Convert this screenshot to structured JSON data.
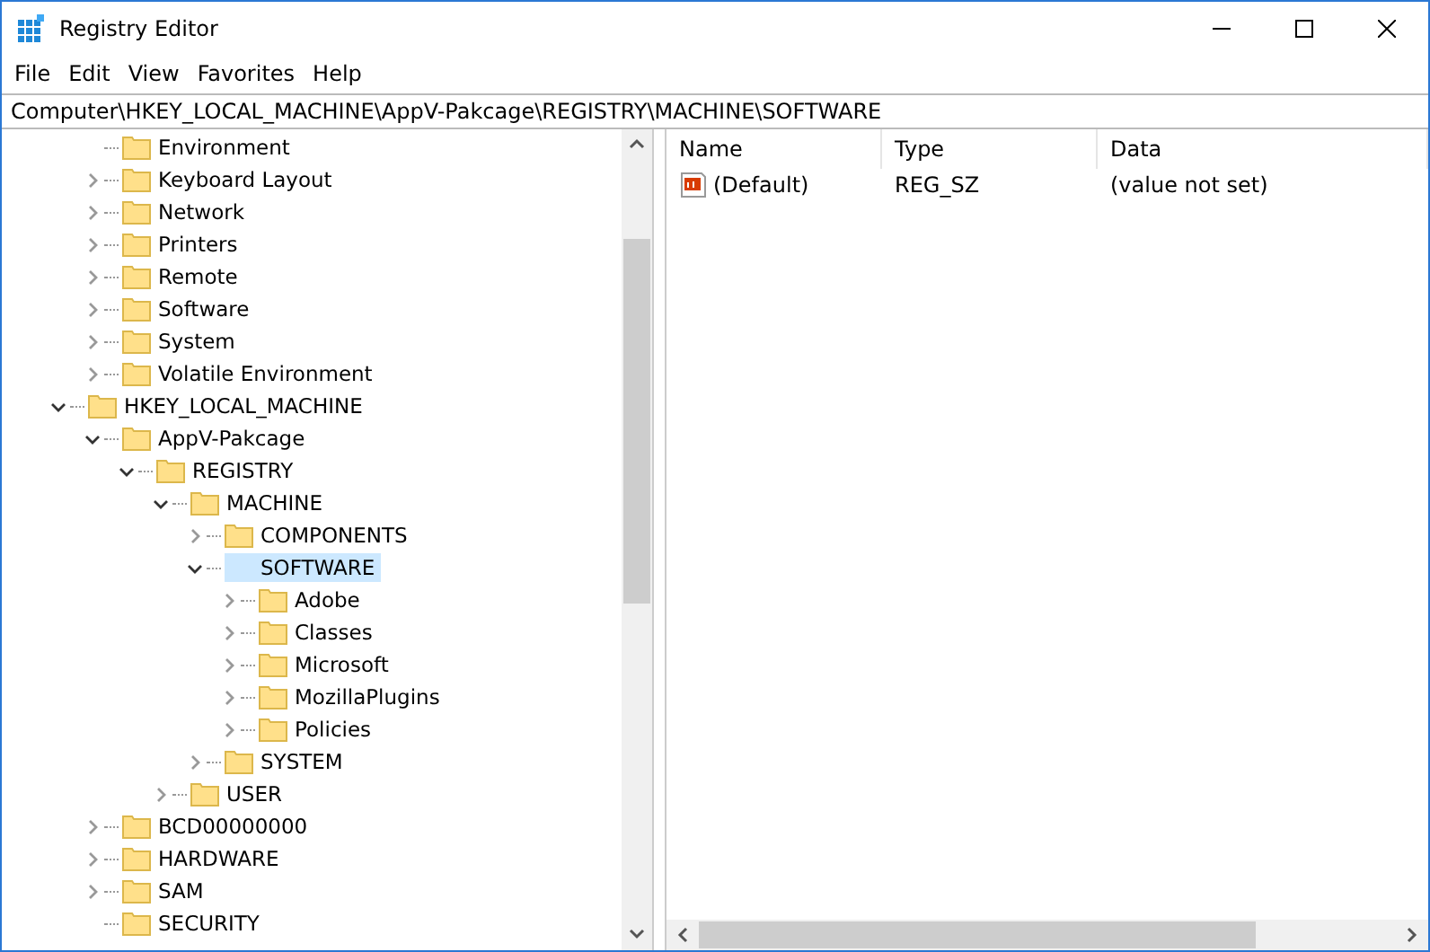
{
  "window": {
    "title": "Registry Editor"
  },
  "menu": [
    {
      "label": "File"
    },
    {
      "label": "Edit"
    },
    {
      "label": "View"
    },
    {
      "label": "Favorites"
    },
    {
      "label": "Help"
    }
  ],
  "address": "Computer\\HKEY_LOCAL_MACHINE\\AppV-Pakcage\\REGISTRY\\MACHINE\\SOFTWARE",
  "scrolled_branch": {
    "children": [
      {
        "label": "Environment",
        "selected": false
      },
      {
        "label": "Keyboard Layout",
        "expanded": false,
        "selected": false
      },
      {
        "label": "Network",
        "expanded": false,
        "selected": false
      },
      {
        "label": "Printers",
        "expanded": false,
        "selected": false
      },
      {
        "label": "Remote",
        "expanded": false,
        "selected": false
      },
      {
        "label": "Software",
        "expanded": false,
        "selected": false
      },
      {
        "label": "System",
        "expanded": false,
        "selected": false
      },
      {
        "label": "Volatile Environment",
        "expanded": false,
        "selected": false
      }
    ]
  },
  "tree": [
    {
      "label": "HKEY_LOCAL_MACHINE",
      "expanded": true,
      "selected": false,
      "children": [
        {
          "label": "AppV-Pakcage",
          "expanded": true,
          "selected": false,
          "children": [
            {
              "label": "REGISTRY",
              "expanded": true,
              "selected": false,
              "children": [
                {
                  "label": "MACHINE",
                  "expanded": true,
                  "selected": false,
                  "children": [
                    {
                      "label": "COMPONENTS",
                      "expanded": false,
                      "selected": false
                    },
                    {
                      "label": "SOFTWARE",
                      "expanded": true,
                      "selected": true,
                      "children": [
                        {
                          "label": "Adobe",
                          "expanded": false,
                          "selected": false
                        },
                        {
                          "label": "Classes",
                          "expanded": false,
                          "selected": false
                        },
                        {
                          "label": "Microsoft",
                          "expanded": false,
                          "selected": false
                        },
                        {
                          "label": "MozillaPlugins",
                          "expanded": false,
                          "selected": false
                        },
                        {
                          "label": "Policies",
                          "expanded": false,
                          "selected": false
                        }
                      ]
                    },
                    {
                      "label": "SYSTEM",
                      "expanded": false,
                      "selected": false
                    }
                  ]
                },
                {
                  "label": "USER",
                  "expanded": false,
                  "selected": false
                }
              ]
            }
          ]
        },
        {
          "label": "BCD00000000",
          "expanded": false,
          "selected": false
        },
        {
          "label": "HARDWARE",
          "expanded": false,
          "selected": false
        },
        {
          "label": "SAM",
          "expanded": false,
          "selected": false
        },
        {
          "label": "SECURITY",
          "selected": false
        }
      ]
    }
  ],
  "values": {
    "columns": [
      "Name",
      "Type",
      "Data"
    ],
    "rows": [
      {
        "name": "(Default)",
        "type": "REG_SZ",
        "data": "(value not set)"
      }
    ]
  }
}
